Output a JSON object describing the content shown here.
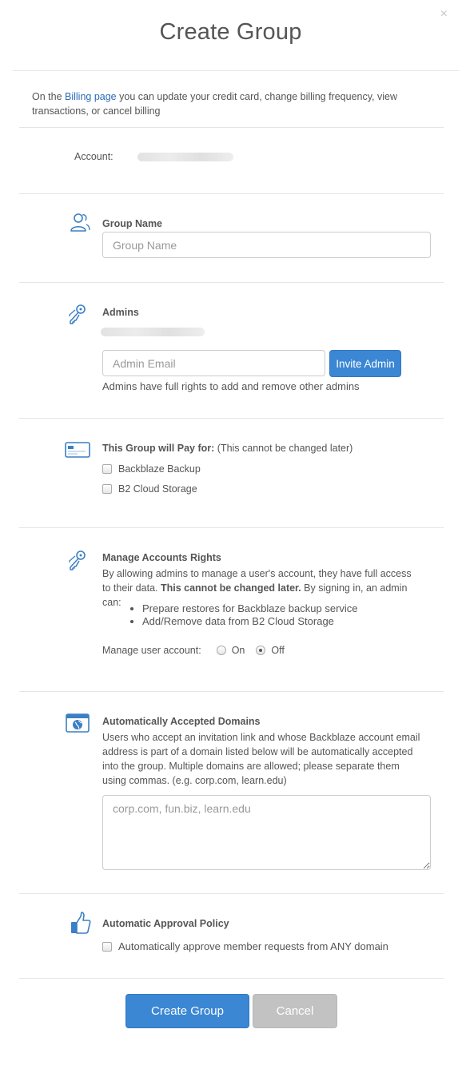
{
  "dialog": {
    "title": "Create Group",
    "close_glyph": "×"
  },
  "billing": {
    "prefix": "On the ",
    "link": "Billing page",
    "suffix": " you can update your credit card, change billing frequency, view transactions, or cancel billing"
  },
  "account": {
    "label": "Account:"
  },
  "group_name": {
    "heading": "Group Name",
    "placeholder": "Group Name",
    "icon": "users-icon"
  },
  "admins": {
    "heading": "Admins",
    "placeholder": "Admin Email",
    "invite_label": "Invite Admin",
    "help": "Admins have full rights to add and remove other admins",
    "icon": "keys-icon"
  },
  "pay_for": {
    "heading": "This Group will Pay for:",
    "note": " (This cannot be changed later)",
    "options": [
      "Backblaze Backup",
      "B2 Cloud Storage"
    ],
    "icon": "credit-card-icon"
  },
  "manage_rights": {
    "heading": "Manage Accounts Rights",
    "text_a": "By allowing admins to manage a user's account, they have full access to their data. ",
    "text_bold": "This cannot be changed later.",
    "text_b": " By signing in, an admin can:",
    "bullets": [
      "Prepare restores for Backblaze backup service",
      "Add/Remove data from B2 Cloud Storage"
    ],
    "manage_label": "Manage user account:",
    "on_label": "On",
    "off_label": "Off",
    "selected": "Off",
    "icon": "keys-icon"
  },
  "domains": {
    "heading": "Automatically Accepted Domains",
    "text": "Users who accept an invitation link and whose Backblaze account email address is part of a domain listed below will be automatically accepted into the group. Multiple domains are allowed; please separate them using commas. (e.g. corp.com, learn.edu)",
    "placeholder": "corp.com, fun.biz, learn.edu",
    "icon": "globe-window-icon"
  },
  "approval": {
    "heading": "Automatic Approval Policy",
    "checkbox_label": "Automatically approve member requests from ANY domain",
    "icon": "thumbs-up-icon"
  },
  "footer": {
    "create_label": "Create Group",
    "cancel_label": "Cancel"
  },
  "colors": {
    "accent": "#3b87d4",
    "link": "#2a6cb6",
    "icon": "#3b7fc4",
    "cancel": "#c2c2c2",
    "text": "#555555"
  }
}
